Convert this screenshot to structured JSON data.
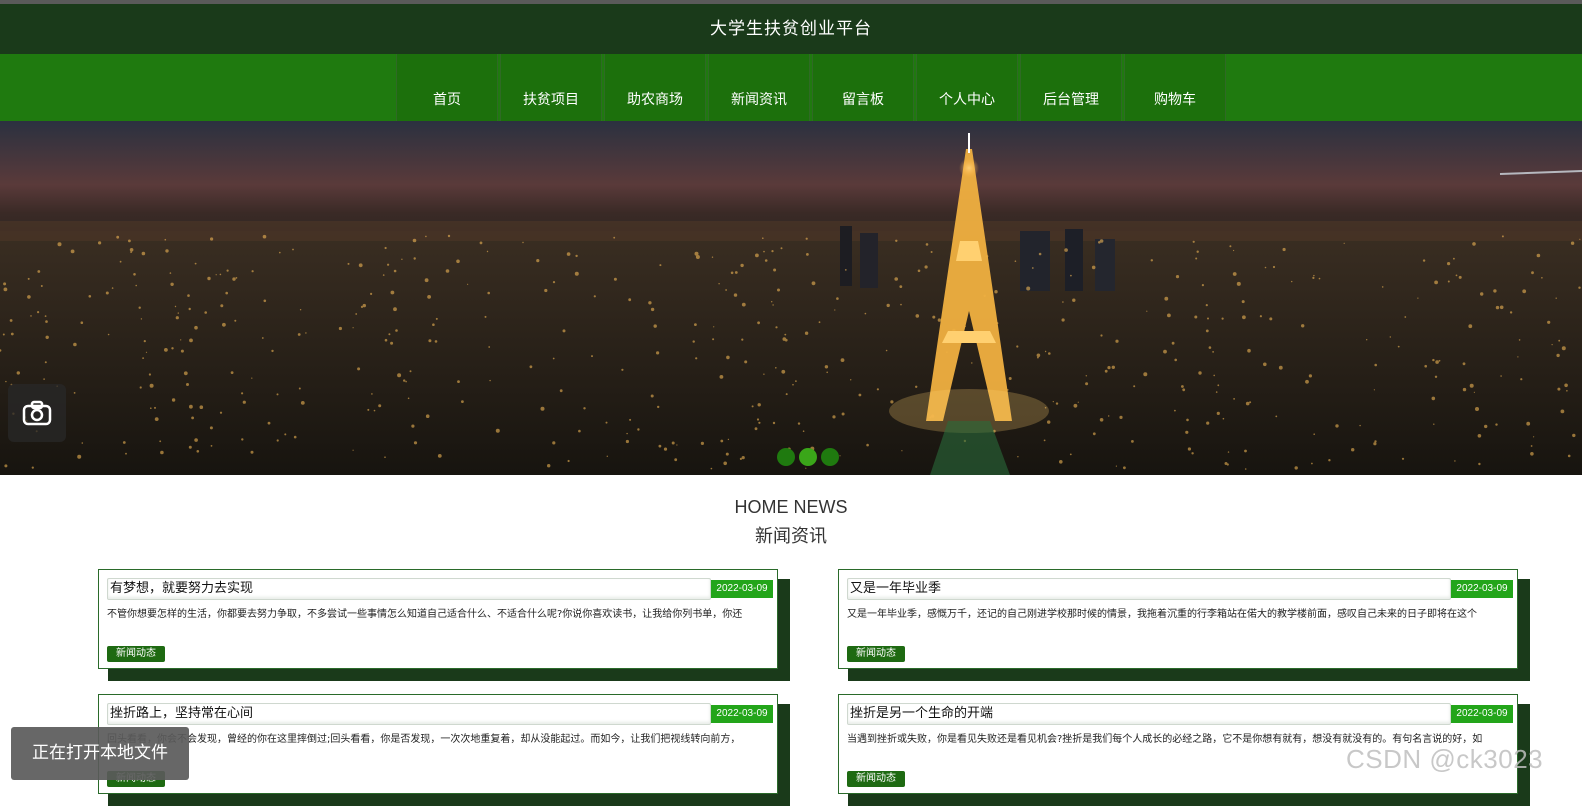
{
  "header": {
    "title": "大学生扶贫创业平台"
  },
  "nav": {
    "items": [
      {
        "label": "首页"
      },
      {
        "label": "扶贫项目"
      },
      {
        "label": "助农商场"
      },
      {
        "label": "新闻资讯"
      },
      {
        "label": "留言板"
      },
      {
        "label": "个人中心"
      },
      {
        "label": "后台管理"
      },
      {
        "label": "购物车"
      }
    ]
  },
  "carousel": {
    "slide_count": 3,
    "active_index": 1,
    "camera_icon": "camera-icon"
  },
  "news_section": {
    "title_en": "HOME NEWS",
    "title_cn": "新闻资讯",
    "cards": [
      {
        "title": "有梦想，就要努力去实现",
        "date": "2022-03-09",
        "summary": "不管你想要怎样的生活，你都要去努力争取，不多尝试一些事情怎么知道自己适合什么、不适合什么呢?你说你喜欢读书，让我给你列书单，你还",
        "tag": "新闻动态"
      },
      {
        "title": "又是一年毕业季",
        "date": "2022-03-09",
        "summary": "又是一年毕业季，感慨万千，还记的自己刚进学校那时候的情景，我拖着沉重的行李箱站在偌大的教学楼前面，感叹自己未来的日子即将在这个",
        "tag": "新闻动态"
      },
      {
        "title": "挫折路上，坚持常在心间",
        "date": "2022-03-09",
        "summary": "回头看看，你会不会发现，曾经的你在这里摔倒过;回头看看，你是否发现，一次次地重复着，却从没能起过。而如今，让我们把视线转向前方，",
        "tag": "新闻动态"
      },
      {
        "title": "挫折是另一个生命的开端",
        "date": "2022-03-09",
        "summary": "当遇到挫折或失败，你是看见失败还是看见机会?挫折是我们每个人成长的必经之路，它不是你想有就有，想没有就没有的。有句名言说的好，如",
        "tag": "新闻动态"
      }
    ]
  },
  "toast": {
    "text": "正在打开本地文件"
  },
  "watermark": {
    "text": "CSDN @ck3023"
  }
}
